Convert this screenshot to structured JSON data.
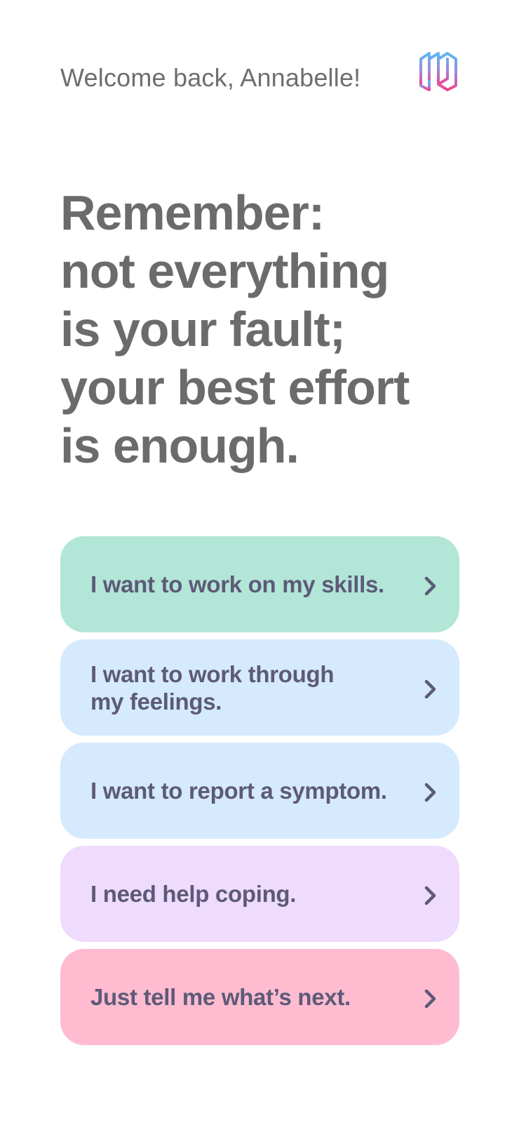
{
  "header": {
    "greeting": "Welcome back, Annabelle!",
    "logo_icon": "app-logo-icon"
  },
  "affirmation": {
    "lines": [
      "Remember:",
      "not everything",
      "is your fault;",
      "your best effort",
      "is enough."
    ]
  },
  "options": [
    {
      "label_lines": [
        "I want to work on my skills."
      ],
      "color": "#b2e6d6",
      "icon": "chevron-right-icon"
    },
    {
      "label_lines": [
        "I want to work through",
        "my feelings."
      ],
      "color": "#d5eafd",
      "icon": "chevron-right-icon"
    },
    {
      "label_lines": [
        "I want to report a symptom."
      ],
      "color": "#d5eafd",
      "icon": "chevron-right-icon"
    },
    {
      "label_lines": [
        "I need help coping."
      ],
      "color": "#eedbfd",
      "icon": "chevron-right-icon"
    },
    {
      "label_lines": [
        "Just tell me what’s next."
      ],
      "color": "#ffbcd0",
      "icon": "chevron-right-icon"
    }
  ],
  "colors": {
    "text_primary": "#6b6b6e",
    "option_text": "#5d5a78",
    "logo_gradient_top": "#5bb8f0",
    "logo_gradient_bottom": "#f0448e"
  }
}
